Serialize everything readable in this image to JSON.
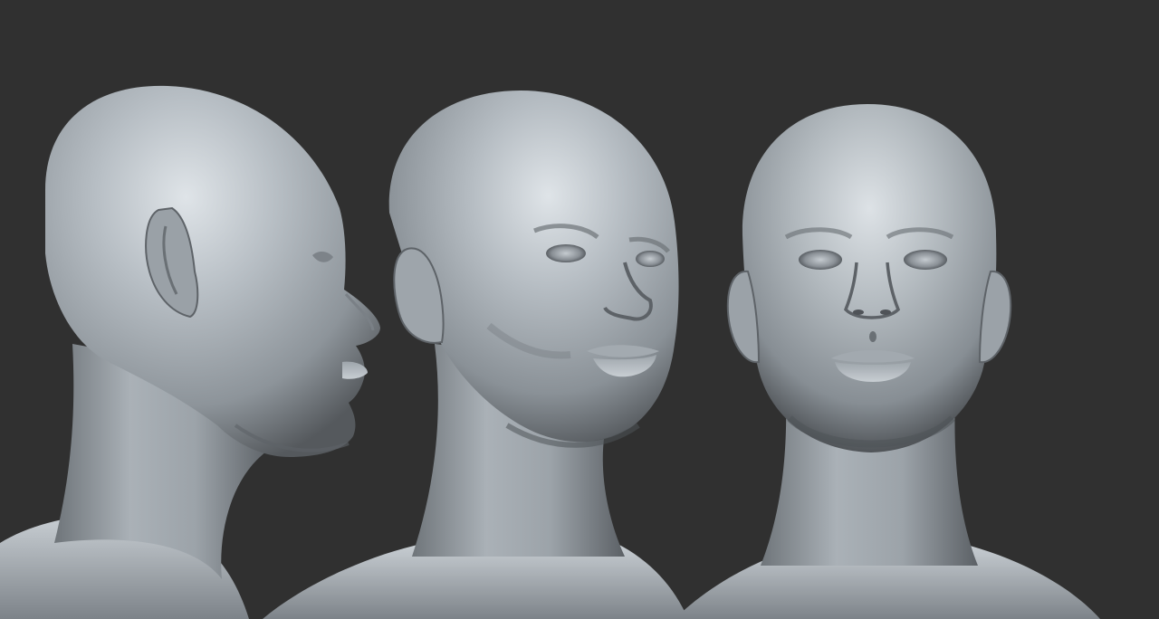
{
  "scene": {
    "background_color": "#303030",
    "clay_color": "#9aa1a8",
    "clay_highlight": "#d7dde2",
    "clay_shadow": "#4a4e52",
    "views": [
      {
        "name": "side-profile-view",
        "orientation": "right-profile"
      },
      {
        "name": "three-quarter-view",
        "orientation": "three-quarter-right"
      },
      {
        "name": "front-view",
        "orientation": "front"
      }
    ]
  }
}
